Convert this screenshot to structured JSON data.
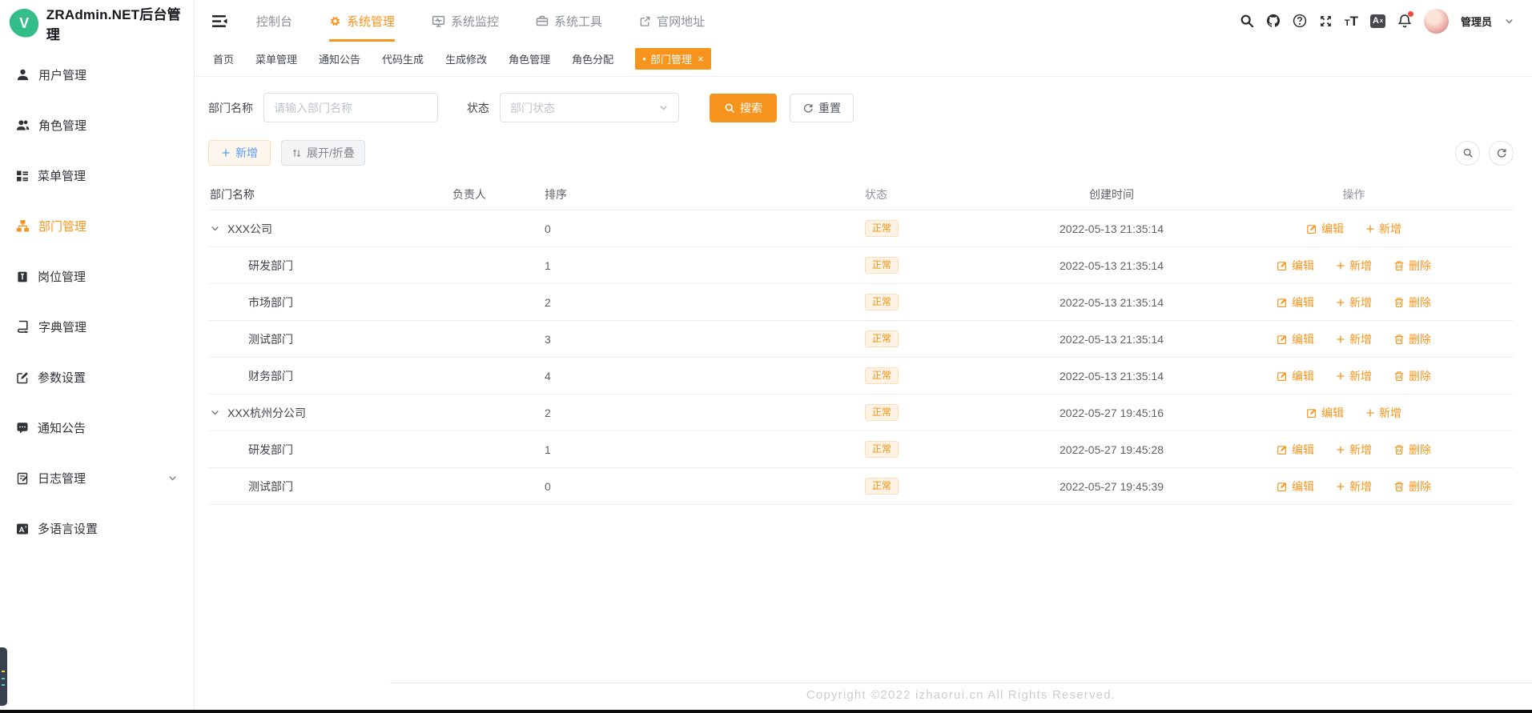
{
  "colors": {
    "accent": "#f7941d",
    "tag_text": "#ef940f",
    "tag_bg": "#fdf2e3",
    "tag_border": "#f8e0bd",
    "add_btn_text": "#5b9df8",
    "logo_green": "#35bd89"
  },
  "sidebar": {
    "logo_letter": "V",
    "logo_text": "ZRAdmin.NET后台管理",
    "items": [
      {
        "key": "users",
        "label": "用户管理",
        "icon": "user-icon",
        "active": false
      },
      {
        "key": "roles",
        "label": "角色管理",
        "icon": "users-icon",
        "active": false
      },
      {
        "key": "menus",
        "label": "菜单管理",
        "icon": "menu-tree-icon",
        "active": false
      },
      {
        "key": "depts",
        "label": "部门管理",
        "icon": "org-tree-icon",
        "active": true
      },
      {
        "key": "posts",
        "label": "岗位管理",
        "icon": "post-badge-icon",
        "active": false
      },
      {
        "key": "dicts",
        "label": "字典管理",
        "icon": "dictionary-icon",
        "active": false
      },
      {
        "key": "params",
        "label": "参数设置",
        "icon": "edit-square-icon",
        "active": false
      },
      {
        "key": "notices",
        "label": "通知公告",
        "icon": "message-icon",
        "active": false
      },
      {
        "key": "logs",
        "label": "日志管理",
        "icon": "log-icon",
        "active": false,
        "has_children": true
      },
      {
        "key": "languages",
        "label": "多语言设置",
        "icon": "translate-icon",
        "active": false
      }
    ]
  },
  "topnav": {
    "items": [
      {
        "key": "console",
        "label": "控制台",
        "active": false
      },
      {
        "key": "system-admin",
        "label": "系统管理",
        "icon": "gear-icon",
        "active": true
      },
      {
        "key": "system-monitor",
        "label": "系统监控",
        "icon": "monitor-icon",
        "active": false
      },
      {
        "key": "system-tools",
        "label": "系统工具",
        "icon": "toolbox-icon",
        "active": false
      },
      {
        "key": "website",
        "label": "官网地址",
        "icon": "external-link-icon",
        "active": false
      }
    ],
    "user_name": "管理员"
  },
  "tabs": [
    {
      "key": "home",
      "label": "首页",
      "active": false
    },
    {
      "key": "menu",
      "label": "菜单管理",
      "active": false
    },
    {
      "key": "notice",
      "label": "通知公告",
      "active": false
    },
    {
      "key": "codegen",
      "label": "代码生成",
      "active": false
    },
    {
      "key": "gen-edit",
      "label": "生成修改",
      "active": false
    },
    {
      "key": "role",
      "label": "角色管理",
      "active": false
    },
    {
      "key": "role-assign",
      "label": "角色分配",
      "active": false
    },
    {
      "key": "dept",
      "label": "部门管理",
      "active": true,
      "closable": true
    }
  ],
  "filters": {
    "dept_name_label": "部门名称",
    "dept_name_placeholder": "请输入部门名称",
    "dept_name_value": "",
    "status_label": "状态",
    "status_placeholder": "部门状态",
    "search_label": "搜索",
    "reset_label": "重置"
  },
  "toolbar": {
    "add_label": "新增",
    "expand_label": "展开/折叠"
  },
  "table": {
    "columns": [
      "部门名称",
      "负责人",
      "排序",
      "状态",
      "创建时间",
      "操作"
    ],
    "action_labels": {
      "edit": "编辑",
      "add": "新增",
      "delete": "删除"
    },
    "rows": [
      {
        "name": "XXX公司",
        "level": 0,
        "expandable": true,
        "leader": "",
        "sort": "0",
        "status": "正常",
        "created": "2022-05-13 21:35:14",
        "can_delete": false
      },
      {
        "name": "研发部门",
        "level": 1,
        "expandable": false,
        "leader": "",
        "sort": "1",
        "status": "正常",
        "created": "2022-05-13 21:35:14",
        "can_delete": true
      },
      {
        "name": "市场部门",
        "level": 1,
        "expandable": false,
        "leader": "",
        "sort": "2",
        "status": "正常",
        "created": "2022-05-13 21:35:14",
        "can_delete": true
      },
      {
        "name": "测试部门",
        "level": 1,
        "expandable": false,
        "leader": "",
        "sort": "3",
        "status": "正常",
        "created": "2022-05-13 21:35:14",
        "can_delete": true
      },
      {
        "name": "财务部门",
        "level": 1,
        "expandable": false,
        "leader": "",
        "sort": "4",
        "status": "正常",
        "created": "2022-05-13 21:35:14",
        "can_delete": true
      },
      {
        "name": "XXX杭州分公司",
        "level": 0,
        "expandable": true,
        "leader": "",
        "sort": "2",
        "status": "正常",
        "created": "2022-05-27 19:45:16",
        "can_delete": false
      },
      {
        "name": "研发部门",
        "level": 1,
        "expandable": false,
        "leader": "",
        "sort": "1",
        "status": "正常",
        "created": "2022-05-27 19:45:28",
        "can_delete": true
      },
      {
        "name": "测试部门",
        "level": 1,
        "expandable": false,
        "leader": "",
        "sort": "0",
        "status": "正常",
        "created": "2022-05-27 19:45:39",
        "can_delete": true
      }
    ]
  },
  "footer": {
    "copyright": "Copyright ©2022 izhaorui.cn All Rights Reserved."
  }
}
